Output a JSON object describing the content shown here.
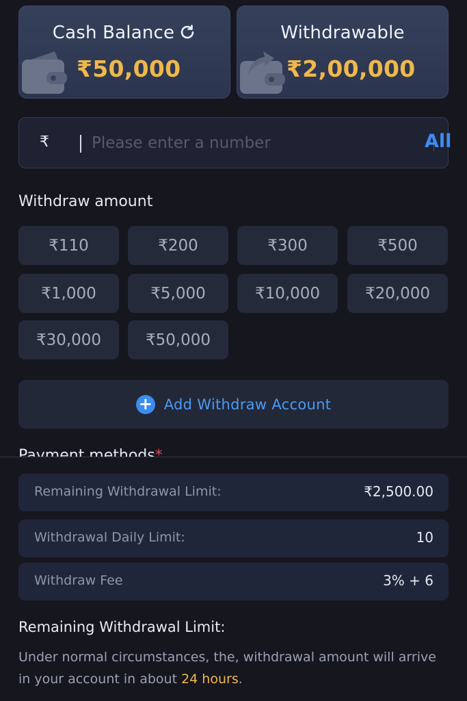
{
  "balances": {
    "cash": {
      "title": "Cash Balance",
      "value": "₹50,000",
      "icon": "refresh-icon"
    },
    "withdrawable": {
      "title": "Withdrawable",
      "value": "₹2,00,000"
    }
  },
  "amount_input": {
    "currency_symbol": "₹",
    "placeholder": "Please enter a number",
    "value": "",
    "all_label": "All"
  },
  "withdraw_amount": {
    "label": "Withdraw amount",
    "options": [
      "₹110",
      "₹200",
      "₹300",
      "₹500",
      "₹1,000",
      "₹5,000",
      "₹10,000",
      "₹20,000",
      "₹30,000",
      "₹50,000"
    ]
  },
  "add_account": {
    "label": "Add Withdraw Account",
    "icon": "plus-circle-icon"
  },
  "payment_methods": {
    "label": "Payment methods",
    "required_mark": "*"
  },
  "limits": [
    {
      "key": "Remaining Withdrawal Limit:",
      "value": "₹2,500.00"
    },
    {
      "key": "Withdrawal Daily Limit:",
      "value": "10"
    },
    {
      "key": "Withdraw Fee",
      "value": "3% + 6"
    }
  ],
  "notes": {
    "title": "Remaining Withdrawal Limit:",
    "body_prefix": "Under normal circumstances, the, withdrawal amount will arrive in your account in about ",
    "body_highlight": "24 hours",
    "body_suffix": "."
  },
  "colors": {
    "accent_blue": "#3d8cf0",
    "money_gold": "#f0b84a",
    "required_red": "#e04848",
    "background": "#16161f"
  }
}
